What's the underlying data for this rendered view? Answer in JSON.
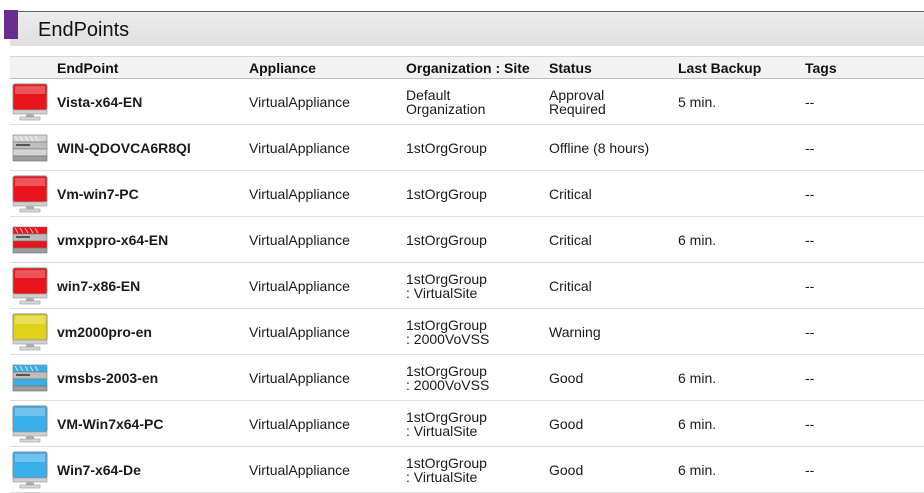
{
  "panel": {
    "title": "EndPoints"
  },
  "columns": {
    "endpoint": "EndPoint",
    "appliance": "Appliance",
    "organization": "Organization : Site",
    "status": "Status",
    "last_backup": "Last Backup",
    "tags": "Tags"
  },
  "colors": {
    "critical": "#e8141c",
    "warning": "#e0d21a",
    "good": "#3aaee8",
    "accent": "#6b2c91"
  },
  "rows": [
    {
      "icon": "monitor-critical",
      "endpoint": "Vista-x64-EN",
      "appliance": "VirtualAppliance",
      "organization": "Default\nOrganization",
      "status": "Approval\nRequired",
      "last_backup": "5 min.",
      "tags": "--"
    },
    {
      "icon": "server-offline",
      "endpoint": "WIN-QDOVCA6R8QI",
      "appliance": "VirtualAppliance",
      "organization": "1stOrgGroup",
      "status": "Offline (8 hours)",
      "last_backup": "",
      "tags": "--"
    },
    {
      "icon": "monitor-critical",
      "endpoint": "Vm-win7-PC",
      "appliance": "VirtualAppliance",
      "organization": "1stOrgGroup",
      "status": "Critical",
      "last_backup": "",
      "tags": "--"
    },
    {
      "icon": "server-critical",
      "endpoint": "vmxppro-x64-EN",
      "appliance": "VirtualAppliance",
      "organization": "1stOrgGroup",
      "status": "Critical",
      "last_backup": "6 min.",
      "tags": "--"
    },
    {
      "icon": "monitor-critical",
      "endpoint": "win7-x86-EN",
      "appliance": "VirtualAppliance",
      "organization": " 1stOrgGroup\n: VirtualSite",
      "status": "Critical",
      "last_backup": "",
      "tags": "--"
    },
    {
      "icon": "monitor-warning",
      "endpoint": "vm2000pro-en",
      "appliance": "VirtualAppliance",
      "organization": " 1stOrgGroup\n: 2000VoVSS",
      "status": "Warning",
      "last_backup": "",
      "tags": "--"
    },
    {
      "icon": "server-good",
      "endpoint": "vmsbs-2003-en",
      "appliance": "VirtualAppliance",
      "organization": " 1stOrgGroup\n: 2000VoVSS",
      "status": "Good",
      "last_backup": "6 min.",
      "tags": "--"
    },
    {
      "icon": "monitor-good",
      "endpoint": "VM-Win7x64-PC",
      "appliance": "VirtualAppliance",
      "organization": " 1stOrgGroup\n: VirtualSite",
      "status": "Good",
      "last_backup": "6 min.",
      "tags": "--"
    },
    {
      "icon": "monitor-good",
      "endpoint": "Win7-x64-De",
      "appliance": "VirtualAppliance",
      "organization": " 1stOrgGroup\n: VirtualSite",
      "status": "Good",
      "last_backup": "6 min.",
      "tags": "--"
    }
  ]
}
